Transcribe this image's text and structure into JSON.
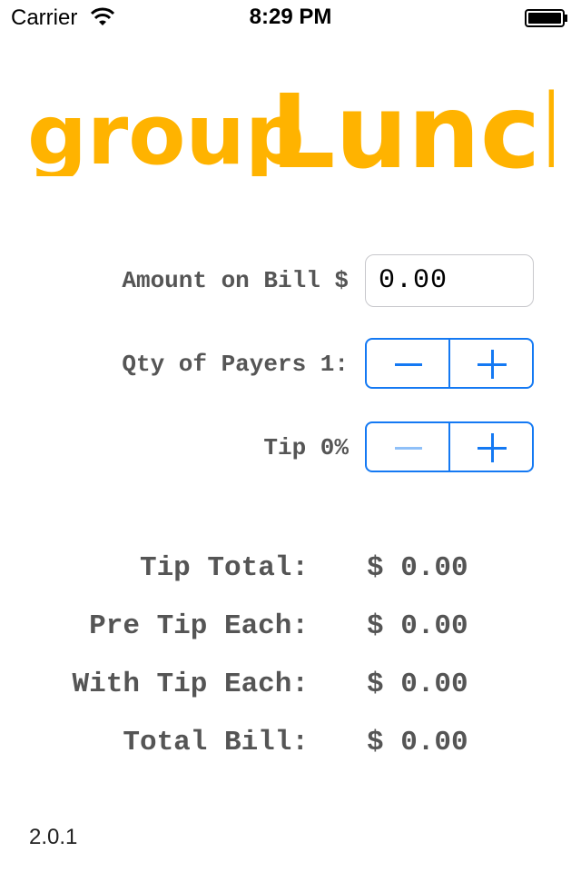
{
  "status_bar": {
    "carrier": "Carrier",
    "time": "8:29 PM"
  },
  "logo": {
    "text_group": "group",
    "text_lunch": "Lunch",
    "color": "#ffb300"
  },
  "form": {
    "amount_label": "Amount on Bill $",
    "amount_value": "0.00",
    "payers_label": "Qty of Payers 1:",
    "tip_label": "Tip 0%"
  },
  "results": {
    "tip_total_label": "Tip Total:",
    "tip_total_value": "$ 0.00",
    "pre_tip_each_label": "Pre Tip Each:",
    "pre_tip_each_value": "$ 0.00",
    "with_tip_each_label": "With Tip Each:",
    "with_tip_each_value": "$ 0.00",
    "total_bill_label": "Total Bill:",
    "total_bill_value": "$ 0.00"
  },
  "footer": {
    "version": "2.0.1"
  },
  "colors": {
    "accent": "#1479f3",
    "label_gray": "#555555"
  }
}
